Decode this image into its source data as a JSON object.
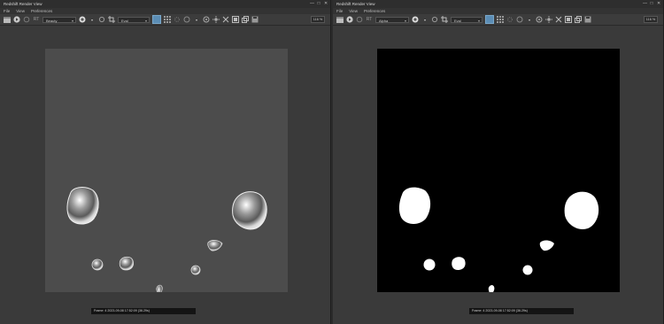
{
  "windows": [
    {
      "title": "Redshift Render View",
      "menu": [
        "File",
        "View",
        "Preferences"
      ],
      "channel_dropdown": "Beauty",
      "region_dropdown": "Eval",
      "zoom": "116 %",
      "status": "Frame: 4  2023-09-08  17:52:09  (36.29s)"
    },
    {
      "title": "Redshift Render View",
      "menu": [
        "File",
        "View",
        "Preferences"
      ],
      "channel_dropdown": "Alpha",
      "region_dropdown": "Eval",
      "zoom": "116 %",
      "status": "Frame: 4  2023-09-08  17:52:09  (36.29s)"
    }
  ],
  "window_controls": [
    "—",
    "□",
    "✕"
  ],
  "colors": {
    "background": "#3a3a3a",
    "beauty_canvas": "#4c4c4c",
    "alpha_canvas": "#000000",
    "active_tool": "#5b8db5"
  }
}
